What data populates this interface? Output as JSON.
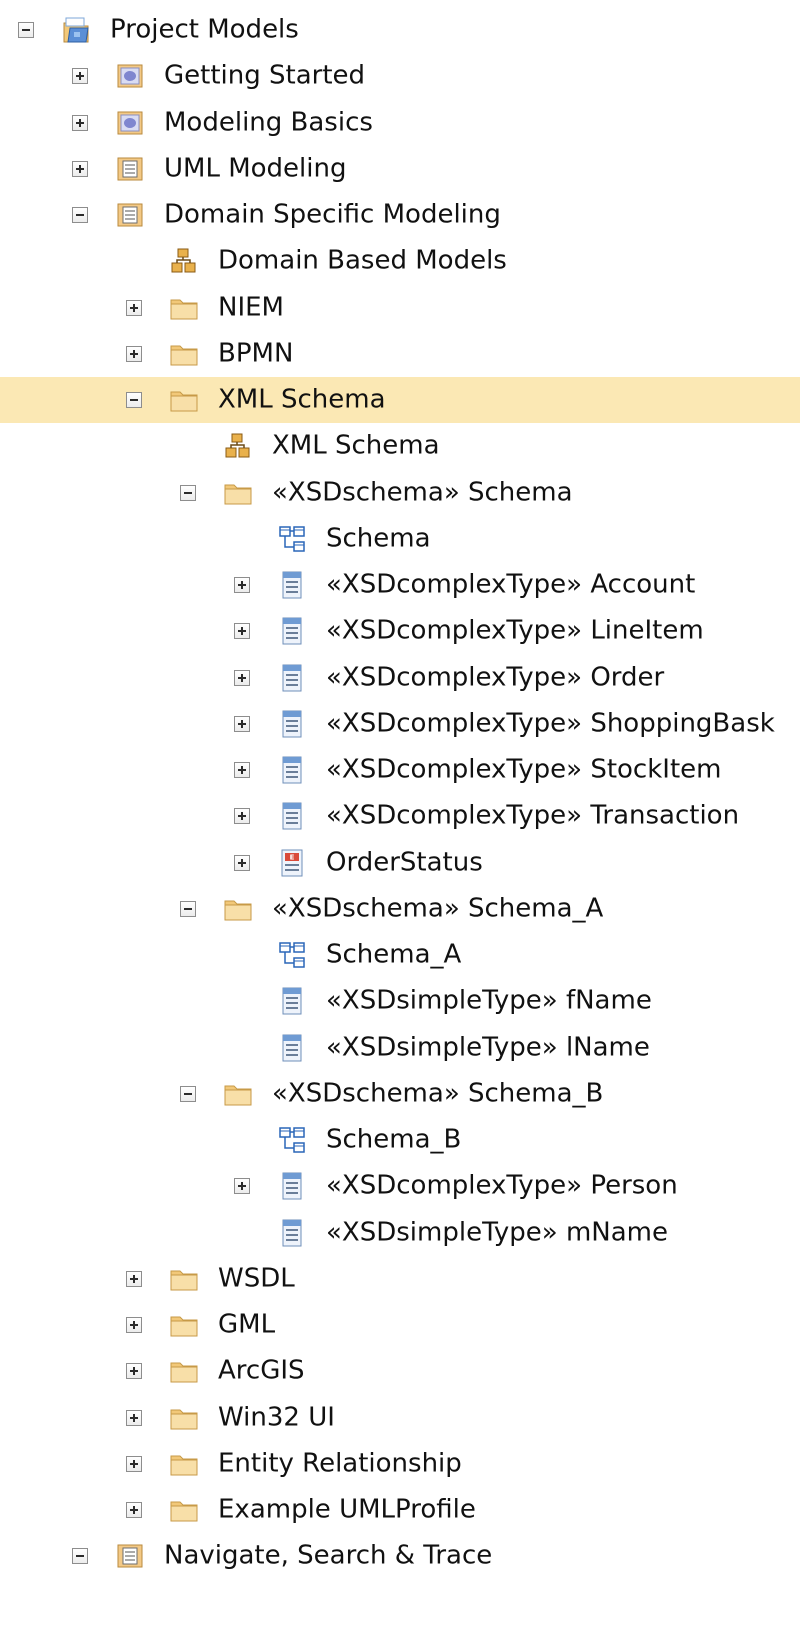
{
  "tree": [
    {
      "label": "Project Models",
      "level": 0,
      "toggle": "minus",
      "icon": "project-root-icon"
    },
    {
      "label": "Getting Started",
      "level": 1,
      "toggle": "plus",
      "icon": "model-view-icon"
    },
    {
      "label": "Modeling Basics",
      "level": 1,
      "toggle": "plus",
      "icon": "model-view-icon"
    },
    {
      "label": "UML Modeling",
      "level": 1,
      "toggle": "plus",
      "icon": "package-view-icon"
    },
    {
      "label": "Domain Specific Modeling",
      "level": 1,
      "toggle": "minus",
      "icon": "package-view-icon"
    },
    {
      "label": "Domain Based Models",
      "level": 2,
      "toggle": "none",
      "icon": "model-diagram-icon"
    },
    {
      "label": "NIEM",
      "level": 2,
      "toggle": "plus",
      "icon": "folder-icon"
    },
    {
      "label": "BPMN",
      "level": 2,
      "toggle": "plus",
      "icon": "folder-icon"
    },
    {
      "label": "XML Schema",
      "level": 2,
      "toggle": "minus",
      "icon": "folder-icon",
      "selected": true
    },
    {
      "label": "XML Schema",
      "level": 3,
      "toggle": "none",
      "icon": "model-diagram-icon"
    },
    {
      "label": "«XSDschema» Schema",
      "level": 3,
      "toggle": "minus",
      "icon": "folder-icon"
    },
    {
      "label": "Schema",
      "level": 4,
      "toggle": "none",
      "icon": "class-diagram-icon"
    },
    {
      "label": "«XSDcomplexType» Account",
      "level": 4,
      "toggle": "plus",
      "icon": "class-element-icon"
    },
    {
      "label": "«XSDcomplexType» LineItem",
      "level": 4,
      "toggle": "plus",
      "icon": "class-element-icon"
    },
    {
      "label": "«XSDcomplexType» Order",
      "level": 4,
      "toggle": "plus",
      "icon": "class-element-icon"
    },
    {
      "label": "«XSDcomplexType» ShoppingBask",
      "level": 4,
      "toggle": "plus",
      "icon": "class-element-icon"
    },
    {
      "label": "«XSDcomplexType» StockItem",
      "level": 4,
      "toggle": "plus",
      "icon": "class-element-icon"
    },
    {
      "label": "«XSDcomplexType» Transaction",
      "level": 4,
      "toggle": "plus",
      "icon": "class-element-icon"
    },
    {
      "label": "OrderStatus",
      "level": 4,
      "toggle": "plus",
      "icon": "enumeration-icon"
    },
    {
      "label": "«XSDschema» Schema_A",
      "level": 3,
      "toggle": "minus",
      "icon": "folder-icon"
    },
    {
      "label": "Schema_A",
      "level": 4,
      "toggle": "none",
      "icon": "class-diagram-icon"
    },
    {
      "label": "«XSDsimpleType» fName",
      "level": 4,
      "toggle": "none",
      "icon": "class-element-icon"
    },
    {
      "label": "«XSDsimpleType» lName",
      "level": 4,
      "toggle": "none",
      "icon": "class-element-icon"
    },
    {
      "label": "«XSDschema» Schema_B",
      "level": 3,
      "toggle": "minus",
      "icon": "folder-icon"
    },
    {
      "label": "Schema_B",
      "level": 4,
      "toggle": "none",
      "icon": "class-diagram-icon"
    },
    {
      "label": "«XSDcomplexType» Person",
      "level": 4,
      "toggle": "plus",
      "icon": "class-element-icon"
    },
    {
      "label": "«XSDsimpleType» mName",
      "level": 4,
      "toggle": "none",
      "icon": "class-element-icon"
    },
    {
      "label": "WSDL",
      "level": 2,
      "toggle": "plus",
      "icon": "folder-icon"
    },
    {
      "label": "GML",
      "level": 2,
      "toggle": "plus",
      "icon": "folder-icon"
    },
    {
      "label": "ArcGIS",
      "level": 2,
      "toggle": "plus",
      "icon": "folder-icon"
    },
    {
      "label": "Win32 UI",
      "level": 2,
      "toggle": "plus",
      "icon": "folder-icon"
    },
    {
      "label": "Entity Relationship",
      "level": 2,
      "toggle": "plus",
      "icon": "folder-icon"
    },
    {
      "label": "Example UMLProfile",
      "level": 2,
      "toggle": "plus",
      "icon": "folder-icon"
    },
    {
      "label": "Navigate, Search & Trace",
      "level": 1,
      "toggle": "minus",
      "icon": "package-view-icon"
    }
  ],
  "colors": {
    "selection": "#fbe8b4",
    "folder": "#f6d59a",
    "text": "#111111"
  }
}
